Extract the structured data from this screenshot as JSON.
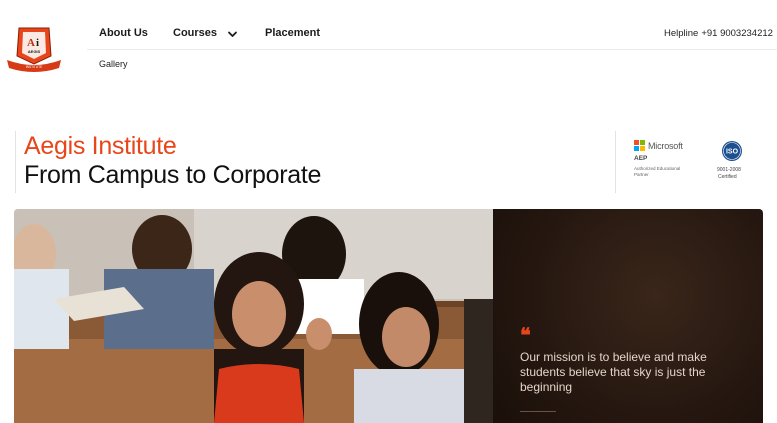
{
  "brand": {
    "logo_text": "AEGIS",
    "logo_sub": "INSTITUTE",
    "accent": "#e8461a"
  },
  "nav": {
    "about": "About Us",
    "courses": "Courses",
    "placement": "Placement",
    "gallery": "Gallery"
  },
  "helpline": {
    "label": "Helpline",
    "number": "+91 9003234212"
  },
  "hero": {
    "title": "Aegis Institute",
    "subtitle": "From Campus to Corporate"
  },
  "certs": {
    "microsoft": "Microsoft",
    "aep": "AEP",
    "aep_sub": "Authorized Educational Partner",
    "iso_label": "ISO",
    "iso_number": "9001-2008",
    "iso_cert": "Certified"
  },
  "mission": {
    "quote_mark": "❝",
    "text": "Our mission is to believe and make students believe that sky is just the beginning"
  }
}
